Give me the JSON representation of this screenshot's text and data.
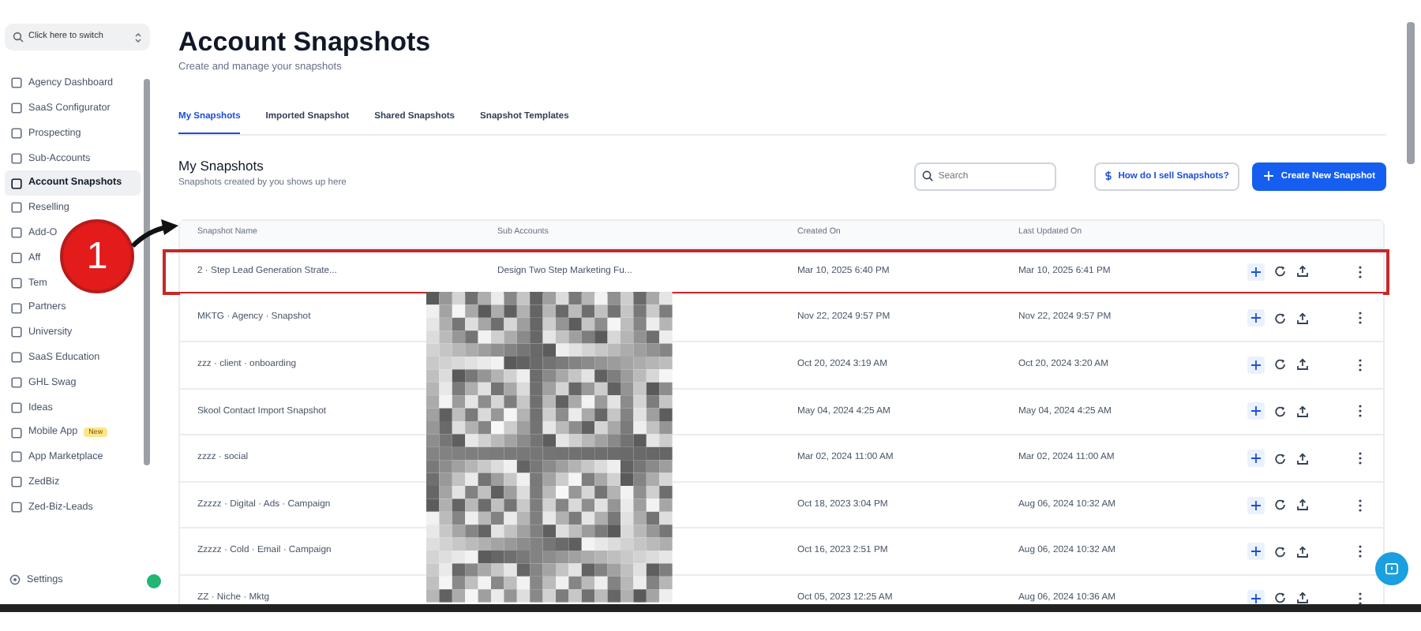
{
  "switcher": {
    "label": "Click here to switch"
  },
  "sidebar": {
    "items": [
      {
        "label": "Agency Dashboard",
        "selected": false
      },
      {
        "label": "SaaS Configurator",
        "selected": false
      },
      {
        "label": "Prospecting",
        "selected": false
      },
      {
        "label": "Sub-Accounts",
        "selected": false
      },
      {
        "label": "Account Snapshots",
        "selected": true
      },
      {
        "label": "Reselling",
        "selected": false
      },
      {
        "label": "Add-O",
        "selected": false
      },
      {
        "label": "Aff",
        "selected": false
      },
      {
        "label": "Tem",
        "selected": false
      },
      {
        "label": "Partners",
        "selected": false
      },
      {
        "label": "University",
        "selected": false
      },
      {
        "label": "SaaS Education",
        "selected": false
      },
      {
        "label": "GHL Swag",
        "selected": false
      },
      {
        "label": "Ideas",
        "selected": false
      },
      {
        "label": "Mobile App",
        "selected": false,
        "badge": "New"
      },
      {
        "label": "App Marketplace",
        "selected": false
      },
      {
        "label": "ZedBiz",
        "selected": false
      },
      {
        "label": "Zed-Biz-Leads",
        "selected": false
      }
    ]
  },
  "settings": {
    "label": "Settings"
  },
  "page": {
    "title": "Account Snapshots",
    "subtitle": "Create and manage your snapshots"
  },
  "tabs": [
    {
      "label": "My Snapshots",
      "selected": true
    },
    {
      "label": "Imported Snapshot",
      "selected": false
    },
    {
      "label": "Shared Snapshots",
      "selected": false
    },
    {
      "label": "Snapshot Templates",
      "selected": false
    }
  ],
  "section": {
    "title": "My Snapshots",
    "subtitle": "Snapshots created by you shows up here"
  },
  "search": {
    "placeholder": "Search"
  },
  "buttons": [
    {
      "label": "How do I sell Snapshots?",
      "kind": "help"
    },
    {
      "label": "Create New Snapshot",
      "kind": "primary"
    }
  ],
  "table": {
    "columns": [
      "Snapshot Name",
      "Sub Accounts",
      "Created On",
      "Last Updated On"
    ],
    "redacted": true,
    "rows": [
      {
        "name": "2 · Step Lead Generation Strate...",
        "sub_accounts": "Design Two Step Marketing Fu...",
        "created": "Mar 10, 2025 6:40 PM",
        "updated": "Mar 10, 2025 6:41 PM",
        "highlighted": true
      },
      {
        "name": "MKTG · Agency · Snapshot",
        "created": "Nov 22, 2024 9:57 PM",
        "updated": "Nov 22, 2024 9:57 PM",
        "highlighted": false
      },
      {
        "name": "zzz · client · onboarding",
        "created": "Oct 20, 2024 3:19 AM",
        "updated": "Oct 20, 2024 3:20 AM",
        "highlighted": false
      },
      {
        "name": "Skool Contact Import Snapshot",
        "created": "May 04, 2024 4:25 AM",
        "updated": "May 04, 2024 4:25 AM",
        "highlighted": false
      },
      {
        "name": "zzzz · social",
        "created": "Mar 02, 2024 11:00 AM",
        "updated": "Mar 02, 2024 11:00 AM",
        "highlighted": false
      },
      {
        "name": "Zzzzz · Digital · Ads · Campaign",
        "created": "Oct 18, 2023 3:04 PM",
        "updated": "Aug 06, 2024 10:32 AM",
        "highlighted": false
      },
      {
        "name": "Zzzzz · Cold · Email · Campaign",
        "created": "Oct 16, 2023 2:51 PM",
        "updated": "Aug 06, 2024 10:32 AM",
        "highlighted": false
      },
      {
        "name": "ZZ · Niche · Mktg",
        "created": "Oct 05, 2023 12:25 AM",
        "updated": "Aug 06, 2024 10:36 AM",
        "highlighted": false
      }
    ]
  },
  "callout": {
    "label": "1"
  }
}
